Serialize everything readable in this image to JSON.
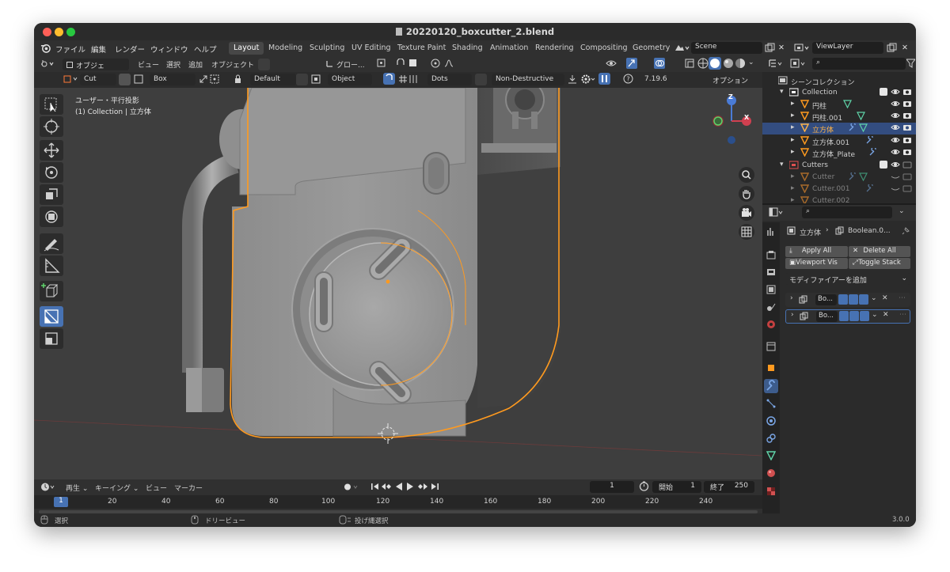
{
  "window": {
    "title": "20220120_boxcutter_2.blend"
  },
  "menu": {
    "items": [
      "ファイル",
      "編集",
      "レンダー",
      "ウィンドウ",
      "ヘルプ"
    ]
  },
  "workspaces": {
    "tabs": [
      "Layout",
      "Modeling",
      "Sculpting",
      "UV Editing",
      "Texture Paint",
      "Shading",
      "Animation",
      "Rendering",
      "Compositing",
      "Geometry"
    ],
    "active": "Layout"
  },
  "scene": {
    "name": "Scene",
    "view_layer": "ViewLayer"
  },
  "viewport_header": {
    "mode": "オブジェク...",
    "view": "ビュー",
    "select": "選択",
    "add": "追加",
    "object": "オブジェクト",
    "transform": "グロー..."
  },
  "tool_header": {
    "cut": "Cut",
    "box": "Box",
    "default": "Default",
    "object": "Object",
    "dots": "Dots",
    "mode": "Non-Destructive",
    "version": "7.19.6",
    "options": "オプション"
  },
  "viewport": {
    "view_label": "ユーザー・平行投影",
    "collection_label": "(1) Collection | 立方体",
    "gizmo": {
      "z": "Z",
      "x": "X"
    }
  },
  "outliner": {
    "root": "シーンコレクション",
    "rows": [
      {
        "label": "Collection",
        "kind": "collection"
      },
      {
        "label": "円柱",
        "kind": "mesh"
      },
      {
        "label": "円柱.001",
        "kind": "mesh"
      },
      {
        "label": "立方体",
        "kind": "mesh",
        "selected": true
      },
      {
        "label": "立方体.001",
        "kind": "mesh"
      },
      {
        "label": "立方体_Plate",
        "kind": "mesh"
      },
      {
        "label": "Cutters",
        "kind": "collection"
      },
      {
        "label": "Cutter",
        "kind": "mesh"
      },
      {
        "label": "Cutter.001",
        "kind": "mesh"
      },
      {
        "label": "Cutter.002",
        "kind": "mesh"
      }
    ]
  },
  "properties": {
    "breadcrumb_object": "立方体",
    "breadcrumb_modifier": "Boolean.0...",
    "apply_all": "Apply All",
    "delete_all": "Delete All",
    "viewport_vis": "Viewport Vis",
    "toggle_stack": "Toggle Stack",
    "add_modifier": "モディファイアーを追加",
    "modifiers": [
      {
        "name": "Bo..."
      },
      {
        "name": "Bo..."
      }
    ]
  },
  "timeline": {
    "playback": "再生",
    "keying": "キーイング",
    "view": "ビュー",
    "marker": "マーカー",
    "current_frame": "1",
    "start_label": "開始",
    "start": "1",
    "end_label": "終了",
    "end": "250",
    "ruler": [
      "1",
      "20",
      "40",
      "60",
      "80",
      "100",
      "120",
      "140",
      "160",
      "180",
      "200",
      "220",
      "240"
    ]
  },
  "statusbar": {
    "select": "選択",
    "dolly": "ドリービュー",
    "lasso": "投げ縄選択",
    "version": "3.0.0"
  },
  "colors": {
    "accent": "#4772b3",
    "selection": "#ff9a1f",
    "bg": "#1d1d1d"
  }
}
